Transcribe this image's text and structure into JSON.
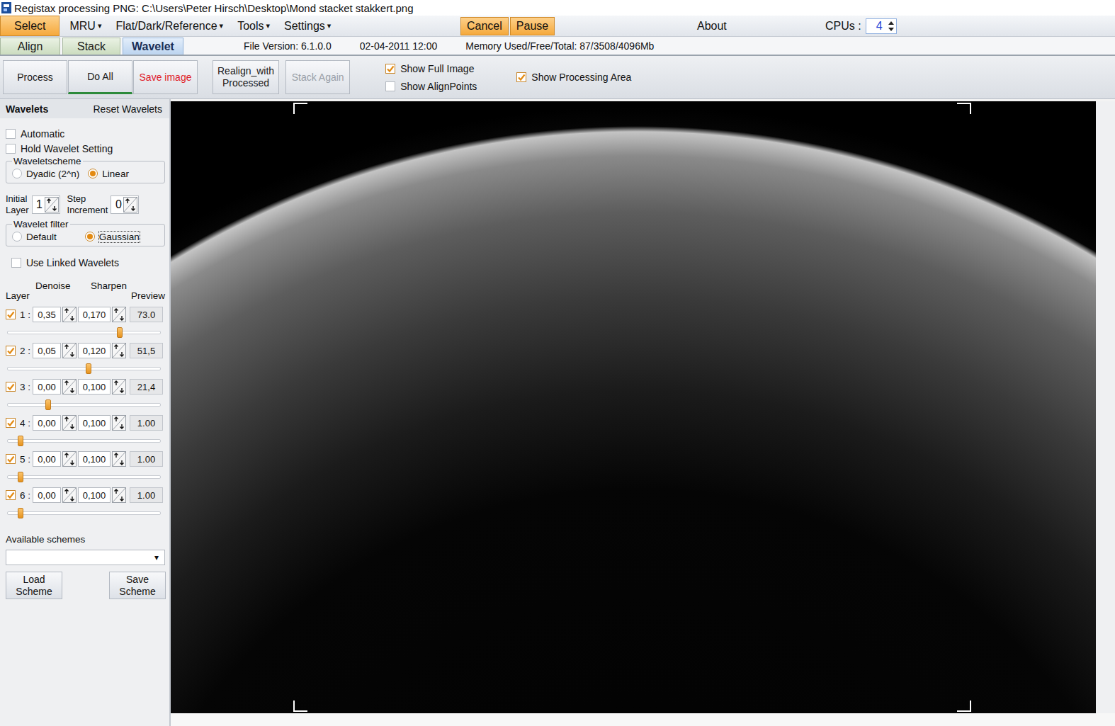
{
  "window": {
    "title": "Registax processing PNG: C:\\Users\\Peter Hirsch\\Desktop\\Mond stacket stakkert.png"
  },
  "menu": [
    {
      "label": "Select",
      "kind": "accent"
    },
    {
      "label": "MRU",
      "kind": "dropdown",
      "caret": "▾"
    },
    {
      "label": "Flat/Dark/Reference",
      "kind": "dropdown",
      "caret": "▾"
    },
    {
      "label": "Tools",
      "kind": "dropdown",
      "caret": "▾"
    },
    {
      "label": "Settings",
      "kind": "dropdown",
      "caret": "▾"
    }
  ],
  "actions": [
    {
      "label": "Cancel"
    },
    {
      "label": "Pause"
    }
  ],
  "about": "About",
  "cpus": {
    "label": "CPUs :",
    "value": "4"
  },
  "tabs": [
    {
      "label": "Align",
      "selected": false
    },
    {
      "label": "Stack",
      "selected": false
    },
    {
      "label": "Wavelet",
      "selected": true
    }
  ],
  "info": [
    "File Version: 6.1.0.0",
    "02-04-2011 12:00",
    "Memory Used/Free/Total: 87/3508/4096Mb"
  ],
  "toolbar": {
    "groups": [
      [
        {
          "lines": [
            "Process"
          ],
          "kind": "plain",
          "active": false,
          "disabled": false
        },
        {
          "lines": [
            "Do All"
          ],
          "kind": "plain",
          "active": true,
          "disabled": false
        },
        {
          "lines": [
            "Save image"
          ],
          "kind": "danger",
          "active": false,
          "disabled": false
        }
      ],
      [
        {
          "lines": [
            "Realign_with",
            "Processed"
          ],
          "kind": "plain",
          "active": false,
          "disabled": false
        },
        {
          "lines": [
            "Stack Again"
          ],
          "kind": "plain",
          "active": false,
          "disabled": true
        }
      ]
    ],
    "checkColumns": [
      [
        {
          "label": "Show Full Image",
          "checked": true
        },
        {
          "label": "Show AlignPoints",
          "checked": false
        }
      ],
      [
        {
          "label": "Show Processing Area",
          "checked": true
        }
      ]
    ]
  },
  "wavelets": {
    "title": "Wavelets",
    "reset": "Reset Wavelets",
    "options": [
      {
        "label": "Automatic",
        "checked": false
      },
      {
        "label": "Hold Wavelet Setting",
        "checked": false
      }
    ],
    "scheme": {
      "legend": "Waveletscheme",
      "choices": [
        {
          "label": "Dyadic (2^n)",
          "selected": false
        },
        {
          "label": "Linear",
          "selected": true
        }
      ]
    },
    "initialLayer": {
      "lines": [
        "Initial",
        "Layer"
      ],
      "value": "1"
    },
    "step": {
      "lines": [
        "Step",
        "Increment"
      ],
      "value": "0"
    },
    "filter": {
      "legend": "Wavelet filter",
      "choices": [
        {
          "label": "Default",
          "selected": false
        },
        {
          "label": "Gaussian",
          "selected": true
        }
      ]
    },
    "linked": {
      "label": "Use Linked Wavelets",
      "checked": false
    },
    "columns": {
      "layer": "Layer",
      "denoise": "Denoise",
      "sharpen": "Sharpen",
      "preview": "Preview"
    },
    "layers": [
      {
        "label": "1 :",
        "checked": true,
        "denoise": "0,35",
        "sharpen": "0,170",
        "preview": "73.0",
        "level": 0.74
      },
      {
        "label": "2 :",
        "checked": true,
        "denoise": "0,05",
        "sharpen": "0,120",
        "preview": "51,5",
        "level": 0.53
      },
      {
        "label": "3 :",
        "checked": true,
        "denoise": "0,00",
        "sharpen": "0,100",
        "preview": "21,4",
        "level": 0.26
      },
      {
        "label": "4 :",
        "checked": true,
        "denoise": "0,00",
        "sharpen": "0,100",
        "preview": "1.00",
        "level": 0.07
      },
      {
        "label": "5 :",
        "checked": true,
        "denoise": "0,00",
        "sharpen": "0,100",
        "preview": "1.00",
        "level": 0.07
      },
      {
        "label": "6 :",
        "checked": true,
        "denoise": "0,00",
        "sharpen": "0,100",
        "preview": "1.00",
        "level": 0.07
      }
    ],
    "schemes": {
      "label": "Available schemes",
      "value": "",
      "caret": "▾"
    },
    "buttons": [
      {
        "lines": [
          "Load",
          "Scheme"
        ]
      },
      {
        "lines": [
          "Save",
          "Scheme"
        ]
      }
    ]
  }
}
